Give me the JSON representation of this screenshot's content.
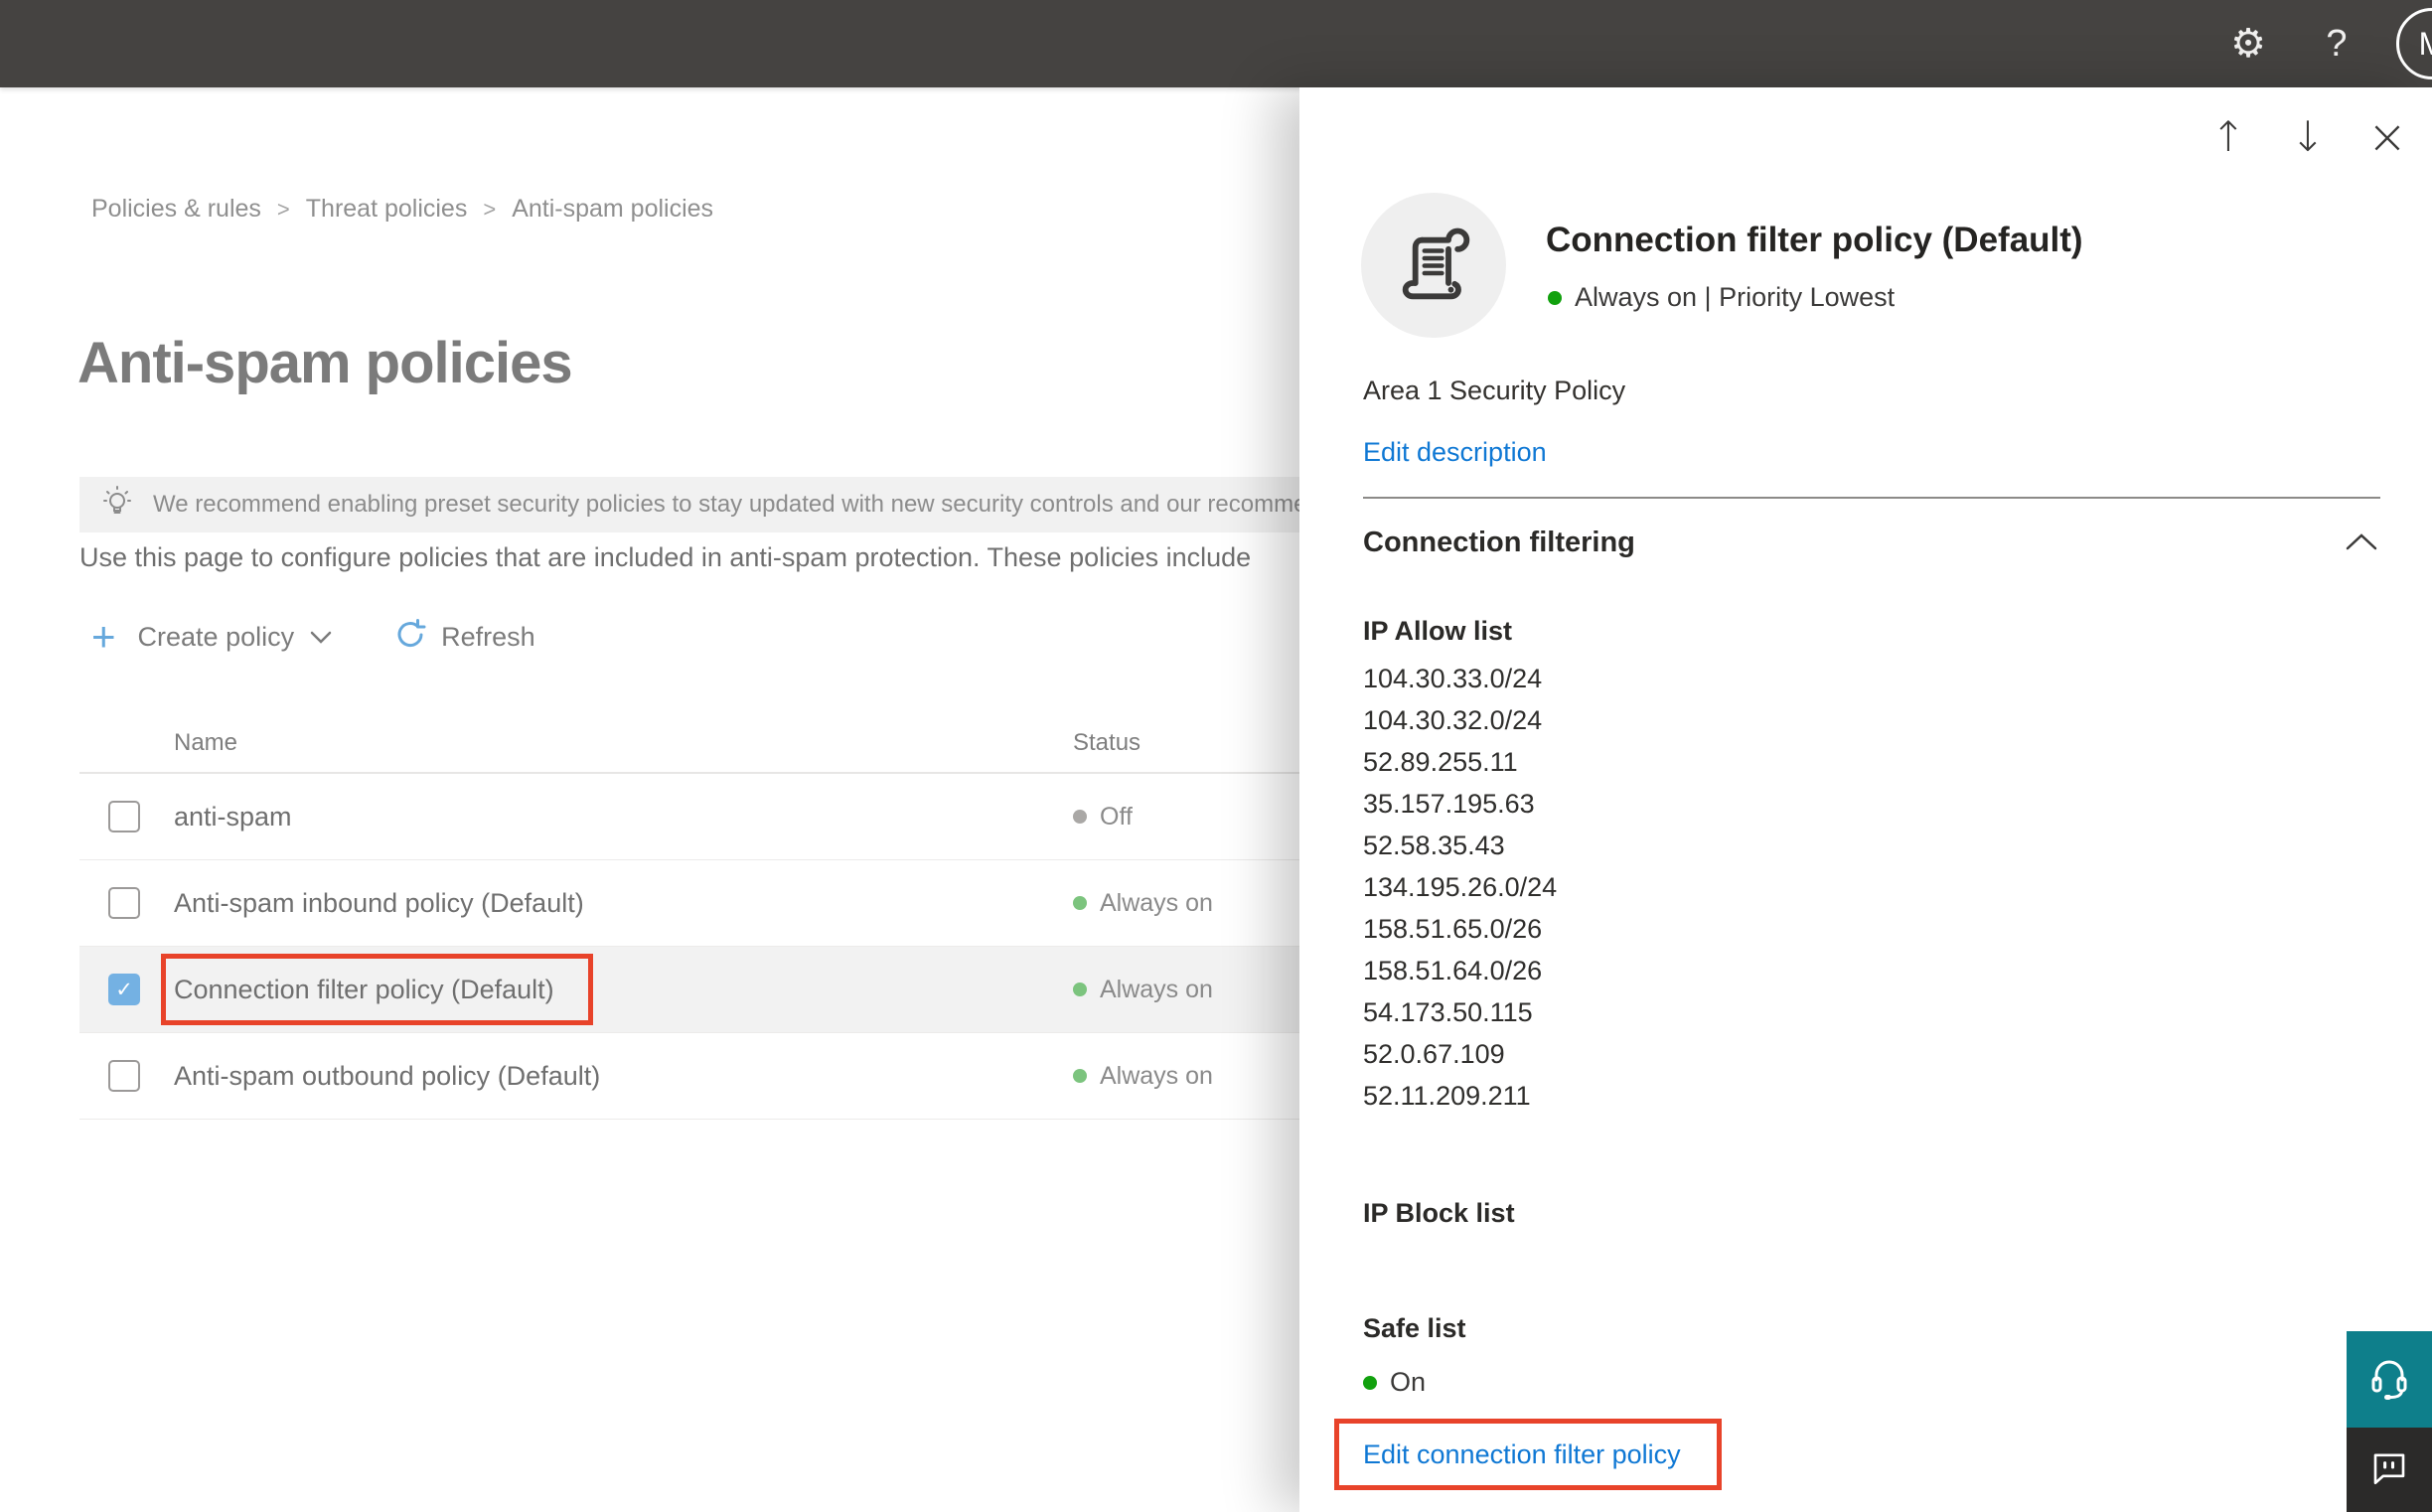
{
  "topbar": {
    "help_label": "?",
    "avatar_initial": "M"
  },
  "icons": {
    "gear": "⚙",
    "up_arrow": "↑",
    "down_arrow": "↓",
    "close": "×",
    "check": "✓",
    "breadcrumb_separator": ">"
  },
  "breadcrumb": {
    "items": [
      "Policies & rules",
      "Threat policies",
      "Anti-spam policies"
    ]
  },
  "page": {
    "title": "Anti-spam policies",
    "banner_text": "We recommend enabling preset security policies to stay updated with new security controls and our recomme",
    "description": "Use this page to configure policies that are included in anti-spam protection. These policies include",
    "toolbar": {
      "create_policy_label": "Create policy",
      "refresh_label": "Refresh"
    },
    "table": {
      "columns": [
        "Name",
        "Status"
      ],
      "rows": [
        {
          "name": "anti-spam",
          "status": "Off",
          "state": "off",
          "checked": false,
          "selected": false,
          "annotated": false
        },
        {
          "name": "Anti-spam inbound policy (Default)",
          "status": "Always on",
          "state": "on",
          "checked": false,
          "selected": false,
          "annotated": false
        },
        {
          "name": "Connection filter policy (Default)",
          "status": "Always on",
          "state": "on",
          "checked": true,
          "selected": true,
          "annotated": true
        },
        {
          "name": "Anti-spam outbound policy (Default)",
          "status": "Always on",
          "state": "on",
          "checked": false,
          "selected": false,
          "annotated": false
        }
      ]
    }
  },
  "flyout": {
    "title": "Connection filter policy (Default)",
    "status_line": "Always on | Priority Lowest",
    "description": "Area 1 Security Policy",
    "edit_description_label": "Edit description",
    "section_title": "Connection filtering",
    "ip_allow": {
      "label": "IP Allow list",
      "items": [
        "104.30.33.0/24",
        "104.30.32.0/24",
        "52.89.255.11",
        "35.157.195.63",
        "52.58.35.43",
        "134.195.26.0/24",
        "158.51.65.0/26",
        "158.51.64.0/26",
        "54.173.50.115",
        "52.0.67.109",
        "52.11.209.211"
      ]
    },
    "ip_block_label": "IP Block list",
    "safe_list_label": "Safe list",
    "safe_list_value": "On",
    "edit_link_label": "Edit connection filter policy"
  },
  "colors": {
    "topbar_bg": "#454341",
    "accent": "#0f78d4",
    "accent_muted": "#66a8dc",
    "annotation_red": "#e8432a",
    "status_on": "#7cc47e",
    "status_off": "#aaa8a6",
    "green_bright": "#12a10e",
    "checkbox_checked": "#74b1e3",
    "teal": "#0e7f8b",
    "dark_btn": "#2b2a29"
  }
}
